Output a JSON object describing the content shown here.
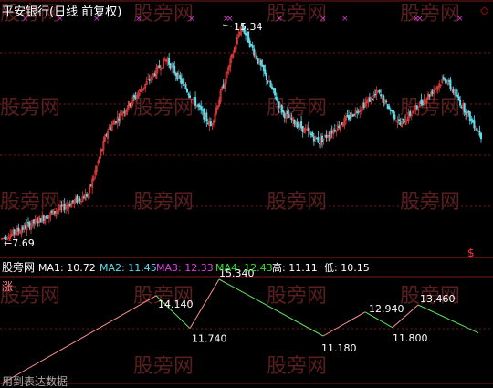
{
  "header": {
    "title": "平安银行(日线 前复权)",
    "marker": "◇",
    "marker_color": "#e01010"
  },
  "watermark": {
    "text": "股旁网",
    "color": "#5a1e1e"
  },
  "main_chart": {
    "high_label": "15.34",
    "low_label": "←7.69",
    "signal_mark": "$",
    "colors": {
      "up": "#e43a3a",
      "down": "#5be0ee",
      "grid": "#7a1a1a",
      "mark": "#d040d0"
    }
  },
  "indicator_bar": {
    "name": "股旁网",
    "items": [
      {
        "label": "MA1:",
        "value": "10.72",
        "color": "#ffffff"
      },
      {
        "label": "MA2:",
        "value": "11.45",
        "color": "#5be0ee"
      },
      {
        "label": "MA3:",
        "value": "12.33",
        "color": "#e040e0"
      },
      {
        "label": "MA4:",
        "value": "12.43",
        "color": "#30e030"
      },
      {
        "label": "高:",
        "value": "11.11",
        "color": "#ffffff"
      },
      {
        "label": "低:",
        "value": "10.15",
        "color": "#ffffff"
      }
    ]
  },
  "zigzag": {
    "tag": "涨",
    "tag_color": "#ff8080",
    "footer_text": "用到表达数据",
    "up_color": "#ff9090",
    "down_color": "#60e060",
    "points": [
      {
        "value": 7.69,
        "label": ""
      },
      {
        "value": 14.14,
        "label": "14.140"
      },
      {
        "value": 11.74,
        "label": "11.740"
      },
      {
        "value": 15.34,
        "label": "15.340"
      },
      {
        "value": 11.18,
        "label": "11.180"
      },
      {
        "value": 12.94,
        "label": "12.940"
      },
      {
        "value": 11.8,
        "label": "11.800"
      },
      {
        "value": 13.46,
        "label": "13.460"
      },
      {
        "value": 11.4,
        "label": ""
      }
    ]
  },
  "chart_data": {
    "type": "line",
    "title": "平安银行(日线 前复权)",
    "series": [
      {
        "name": "MA1",
        "last": 10.72
      },
      {
        "name": "MA2",
        "last": 11.45
      },
      {
        "name": "MA3",
        "last": 12.33
      },
      {
        "name": "MA4",
        "last": 12.43
      }
    ],
    "annotations": [
      "15.34",
      "7.69"
    ],
    "price_range": [
      7.69,
      15.34
    ],
    "grid": true
  }
}
